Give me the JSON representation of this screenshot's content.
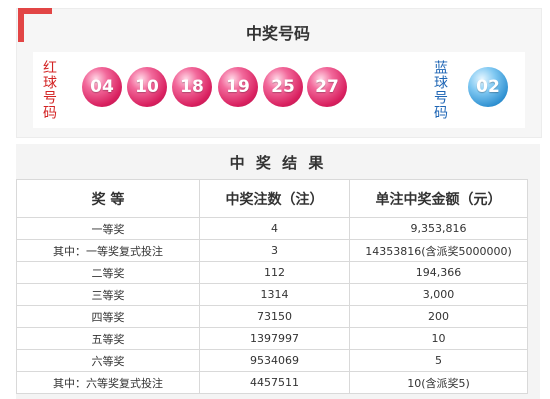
{
  "header": {
    "title": "中奖号码"
  },
  "red_label": "红球号码",
  "blue_label": "蓝球号码",
  "red_balls": [
    "04",
    "10",
    "18",
    "19",
    "25",
    "27"
  ],
  "blue_balls": [
    "02"
  ],
  "colors": {
    "accent": "#e24545",
    "red_ball": "#d8205f",
    "blue_ball": "#2d8fd0",
    "red_text": "#d32424",
    "blue_text": "#1f66b5"
  },
  "results": {
    "title": "中 奖 结 果",
    "columns": [
      "奖 等",
      "中奖注数（注）",
      "单注中奖金额（元）"
    ],
    "rows": [
      [
        "一等奖",
        "4",
        "9,353,816"
      ],
      [
        "其中：一等奖复式投注",
        "3",
        "14353816(含派奖5000000)"
      ],
      [
        "二等奖",
        "112",
        "194,366"
      ],
      [
        "三等奖",
        "1314",
        "3,000"
      ],
      [
        "四等奖",
        "73150",
        "200"
      ],
      [
        "五等奖",
        "1397997",
        "10"
      ],
      [
        "六等奖",
        "9534069",
        "5"
      ],
      [
        "其中：六等奖复式投注",
        "4457511",
        "10(含派奖5)"
      ]
    ]
  }
}
